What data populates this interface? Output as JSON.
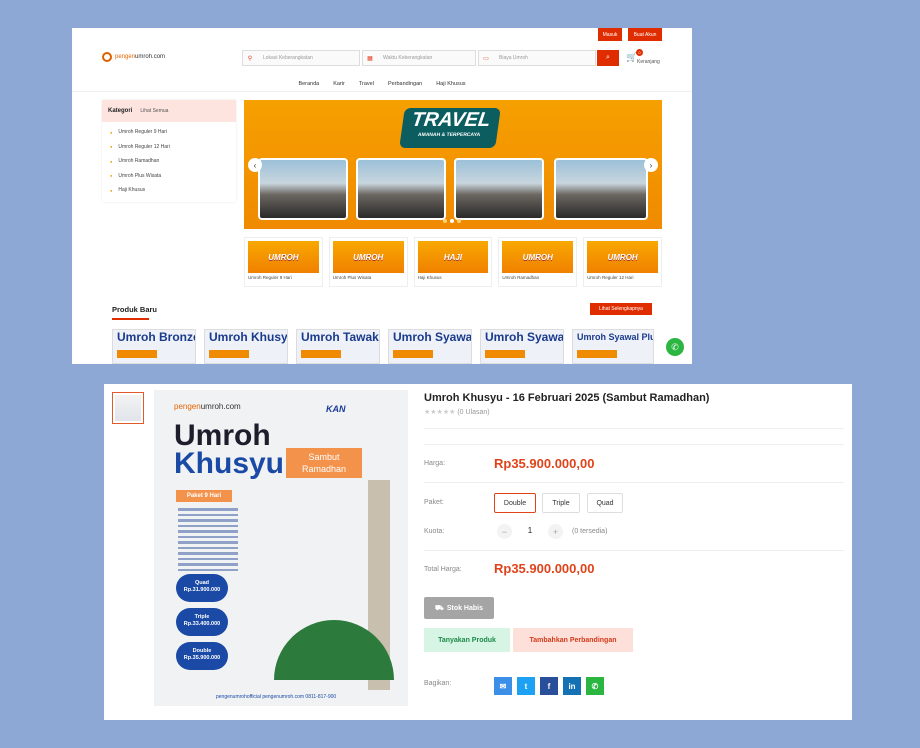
{
  "top": {
    "masuk": "Masuk",
    "buat_akun": "Buat Akun"
  },
  "logo": {
    "pre": "pengen",
    "post": "umroh.com"
  },
  "search": {
    "lokasi": "Lokasi Keberangkatan",
    "waktu": "Waktu Keberangkatan",
    "biaya": "Biaya Umroh"
  },
  "cart": {
    "count": "0",
    "label": "Keranjang"
  },
  "nav": [
    "Beranda",
    "Karir",
    "Travel",
    "Perbandingan",
    "Haji Khusus"
  ],
  "kategori": {
    "title": "Kategori",
    "all": "Lihat Semua",
    "items": [
      "Umroh Reguler 9 Hari",
      "Umroh Reguler 12 Hari",
      "Umroh Ramadhan",
      "Umroh Plus Wisata",
      "Haji Khusus"
    ]
  },
  "hero": {
    "title": "TRAVEL",
    "sub": "AMANAH & TERPERCAYA"
  },
  "tiles": [
    {
      "img": "UMROH",
      "label": "Umroh Reguler 9 Hari"
    },
    {
      "img": "UMROH",
      "label": "Umroh Plus Wisata"
    },
    {
      "img": "HAJI",
      "label": "Haji Khusus"
    },
    {
      "img": "UMROH",
      "label": "Umroh Ramadhan"
    },
    {
      "img": "UMROH",
      "label": "Umroh Reguler 12 Hari"
    }
  ],
  "produk": {
    "title": "Produk Baru",
    "btn": "Lihat Selengkapnya",
    "cards": [
      "Umroh Bronze",
      "Umroh Khusyu",
      "Umroh Tawakal",
      "Umroh Syawal",
      "Umroh Syawal",
      "Umroh Syawal Plus Thaif"
    ]
  },
  "poster": {
    "brand_pre": "pengen",
    "brand_post": "umroh.com",
    "kan": "KAN",
    "h1": "Umroh",
    "h2": "Khusyu",
    "sambut": "Sambut Ramadhan",
    "paket": "Paket 9 Hari",
    "quad": "Quad",
    "quad_p": "Rp.31.900.000",
    "triple": "Triple",
    "triple_p": "Rp.33.400.000",
    "double": "Double",
    "double_p": "Rp.35.900.000",
    "footer": "pengenumrohofficial  pengenumroh.com  0811-817-900"
  },
  "product": {
    "title": "Umroh Khusyu - 16 Februari 2025 (Sambut Ramadhan)",
    "stars": "★★★★★",
    "reviews": "(0 Ulasan)",
    "harga_label": "Harga:",
    "harga": "Rp35.900.000,00",
    "paket_label": "Paket:",
    "paket_opts": [
      "Double",
      "Triple",
      "Quad"
    ],
    "kuota_label": "Kuota:",
    "qty": "1",
    "tersedia": "(0 tersedia)",
    "total_label": "Total Harga:",
    "total": "Rp35.900.000,00",
    "stok": "Stok Habis",
    "tanya": "Tanyakan Produk",
    "banding": "Tambahkan Perbandingan",
    "bagikan": "Bagikan:"
  }
}
